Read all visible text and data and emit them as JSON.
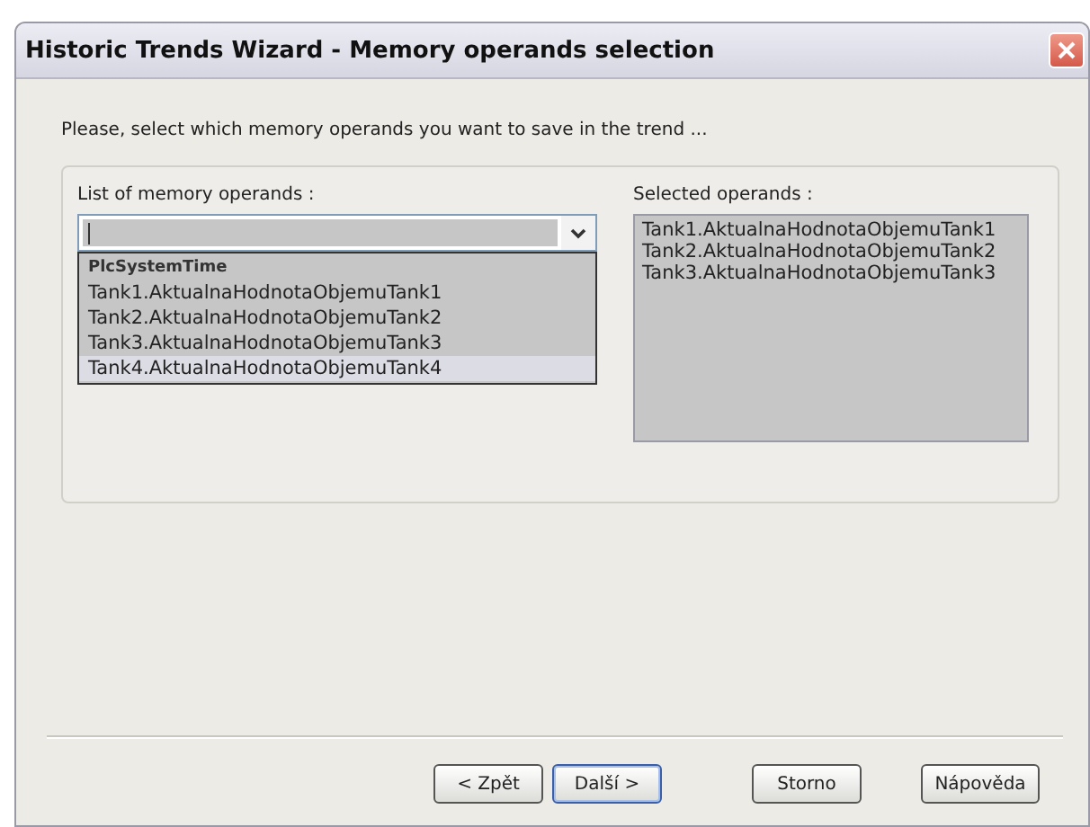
{
  "window": {
    "title": "Historic Trends Wizard - Memory operands selection"
  },
  "instruction": "Please, select which memory operands you want to save in the trend ...",
  "operand_list": {
    "label": "List of memory operands :",
    "items": [
      {
        "label": "PlcSystemTime",
        "selected": false
      },
      {
        "label": "Tank1.AktualnaHodnotaObjemuTank1",
        "selected": false
      },
      {
        "label": "Tank2.AktualnaHodnotaObjemuTank2",
        "selected": false
      },
      {
        "label": "Tank3.AktualnaHodnotaObjemuTank3",
        "selected": false
      },
      {
        "label": "Tank4.AktualnaHodnotaObjemuTank4",
        "selected": true
      }
    ]
  },
  "selected_operands": {
    "label": "Selected operands :",
    "items": [
      "Tank1.AktualnaHodnotaObjemuTank1",
      "Tank2.AktualnaHodnotaObjemuTank2",
      "Tank3.AktualnaHodnotaObjemuTank3"
    ]
  },
  "buttons": [
    {
      "label": "< Zpět",
      "default": false
    },
    {
      "label": "Další >",
      "default": true
    },
    {
      "label": "Storno",
      "default": false
    },
    {
      "label": "Nápověda",
      "default": false
    }
  ]
}
